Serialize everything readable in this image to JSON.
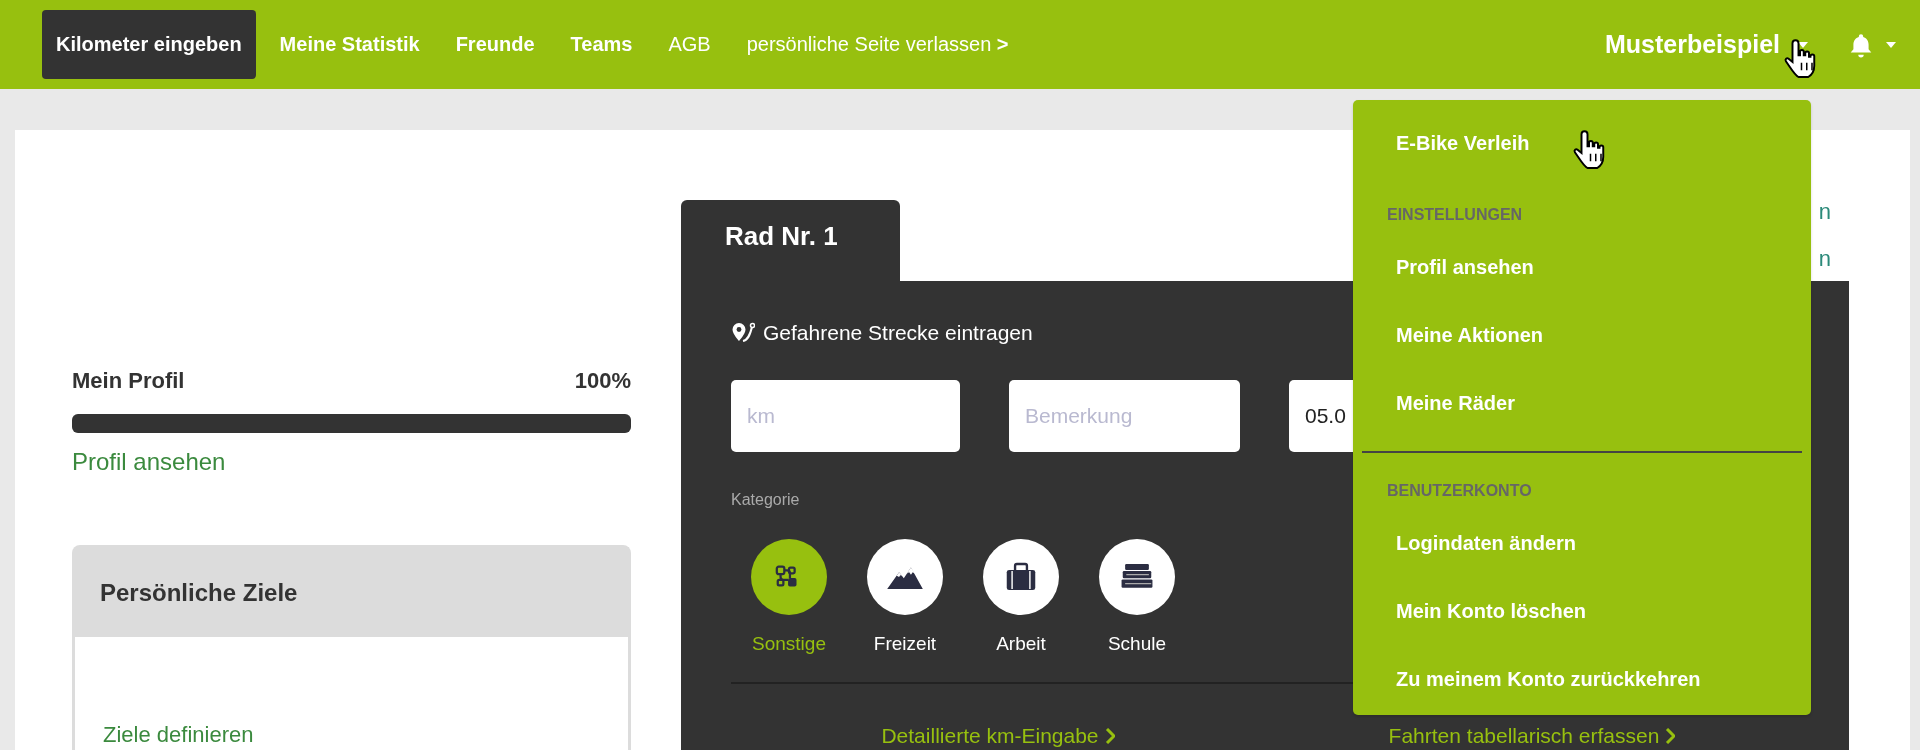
{
  "nav": {
    "items": [
      {
        "label": "Kilometer eingeben",
        "kind": "primary",
        "selected": true
      },
      {
        "label": "Meine Statistik",
        "kind": "primary",
        "selected": false
      },
      {
        "label": "Freunde",
        "kind": "primary",
        "selected": false
      },
      {
        "label": "Teams",
        "kind": "primary",
        "selected": false
      },
      {
        "label": "AGB",
        "kind": "plain",
        "selected": false
      },
      {
        "label": "persönliche Seite verlassen **>**",
        "kind": "plain",
        "selected": false
      }
    ],
    "user": {
      "name": "Musterbeispiel",
      "expanded": true
    }
  },
  "profile": {
    "title": "Mein Profil",
    "percent": "100%",
    "level": 1,
    "link": "Profil ansehen"
  },
  "goals": {
    "title": "Persönliche Ziele",
    "link": "Ziele definieren"
  },
  "bike_tabs": [
    {
      "label": "Rad Nr. 1",
      "selected": true
    }
  ],
  "side_links": [
    {
      "label": "n"
    },
    {
      "label": "n"
    }
  ],
  "entry": {
    "heading": "Gefahrene Strecke eintragen",
    "fields": [
      {
        "placeholder": "km"
      },
      {
        "placeholder": "Bemerkung"
      },
      {
        "value": "05.0"
      }
    ],
    "category_label": "Kategorie",
    "categories": [
      {
        "label": "Sonstige",
        "kind": "other",
        "selected": true
      },
      {
        "label": "Freizeit",
        "kind": "leisure",
        "selected": false
      },
      {
        "label": "Arbeit",
        "kind": "work",
        "selected": false
      },
      {
        "label": "Schule",
        "kind": "school",
        "selected": false
      }
    ],
    "links": [
      {
        "label": "Detaillierte km-Eingabe"
      },
      {
        "label": "Fahrten tabellarisch erfassen"
      }
    ]
  },
  "user_menu": {
    "entries": [
      {
        "kind": "item",
        "label": "E-Bike Verleih"
      },
      {
        "kind": "header",
        "label": "EINSTELLUNGEN"
      },
      {
        "kind": "item",
        "label": "Profil ansehen"
      },
      {
        "kind": "item",
        "label": "Meine Aktionen"
      },
      {
        "kind": "item",
        "label": "Meine Räder"
      },
      {
        "kind": "divider"
      },
      {
        "kind": "header",
        "label": "BENUTZERKONTO"
      },
      {
        "kind": "item",
        "label": "Logindaten ändern"
      },
      {
        "kind": "item",
        "label": "Mein Konto löschen"
      },
      {
        "kind": "item",
        "label": "Zu meinem Konto zurückkehren"
      }
    ]
  }
}
